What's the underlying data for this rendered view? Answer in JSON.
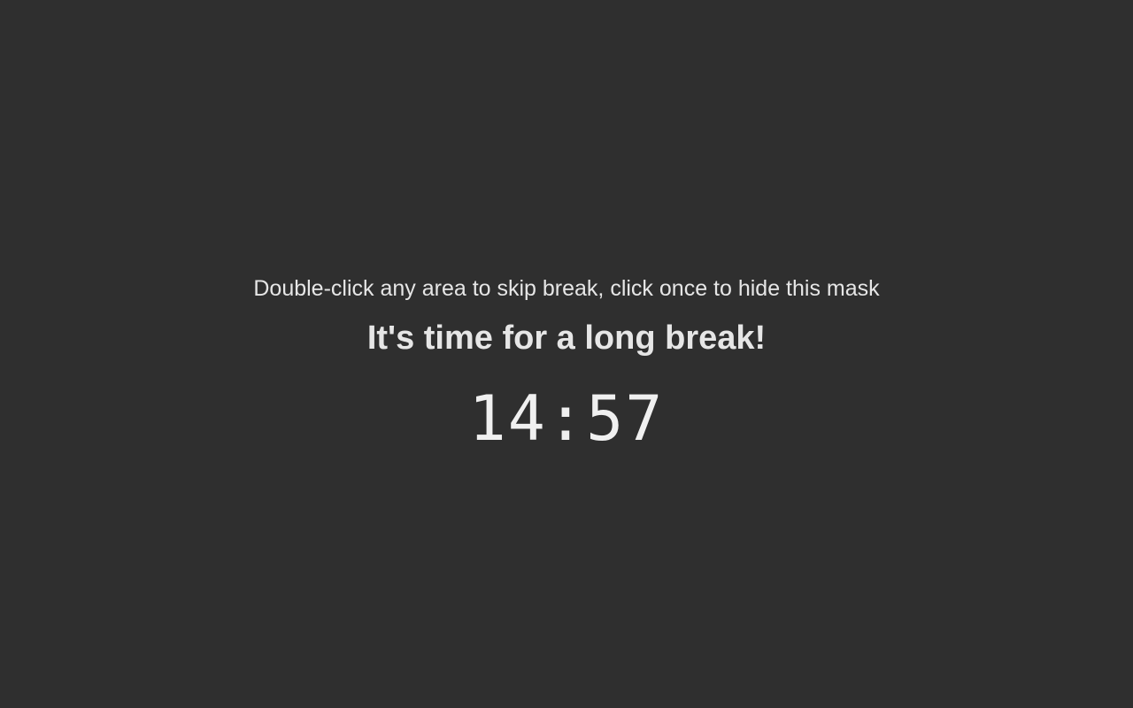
{
  "mask": {
    "hint": "Double-click any area to skip break, click once to hide this mask",
    "title": "It's time for a long break!",
    "timer": "14:57"
  },
  "colors": {
    "background": "#2f2f2f",
    "text": "#e6e6e6"
  }
}
